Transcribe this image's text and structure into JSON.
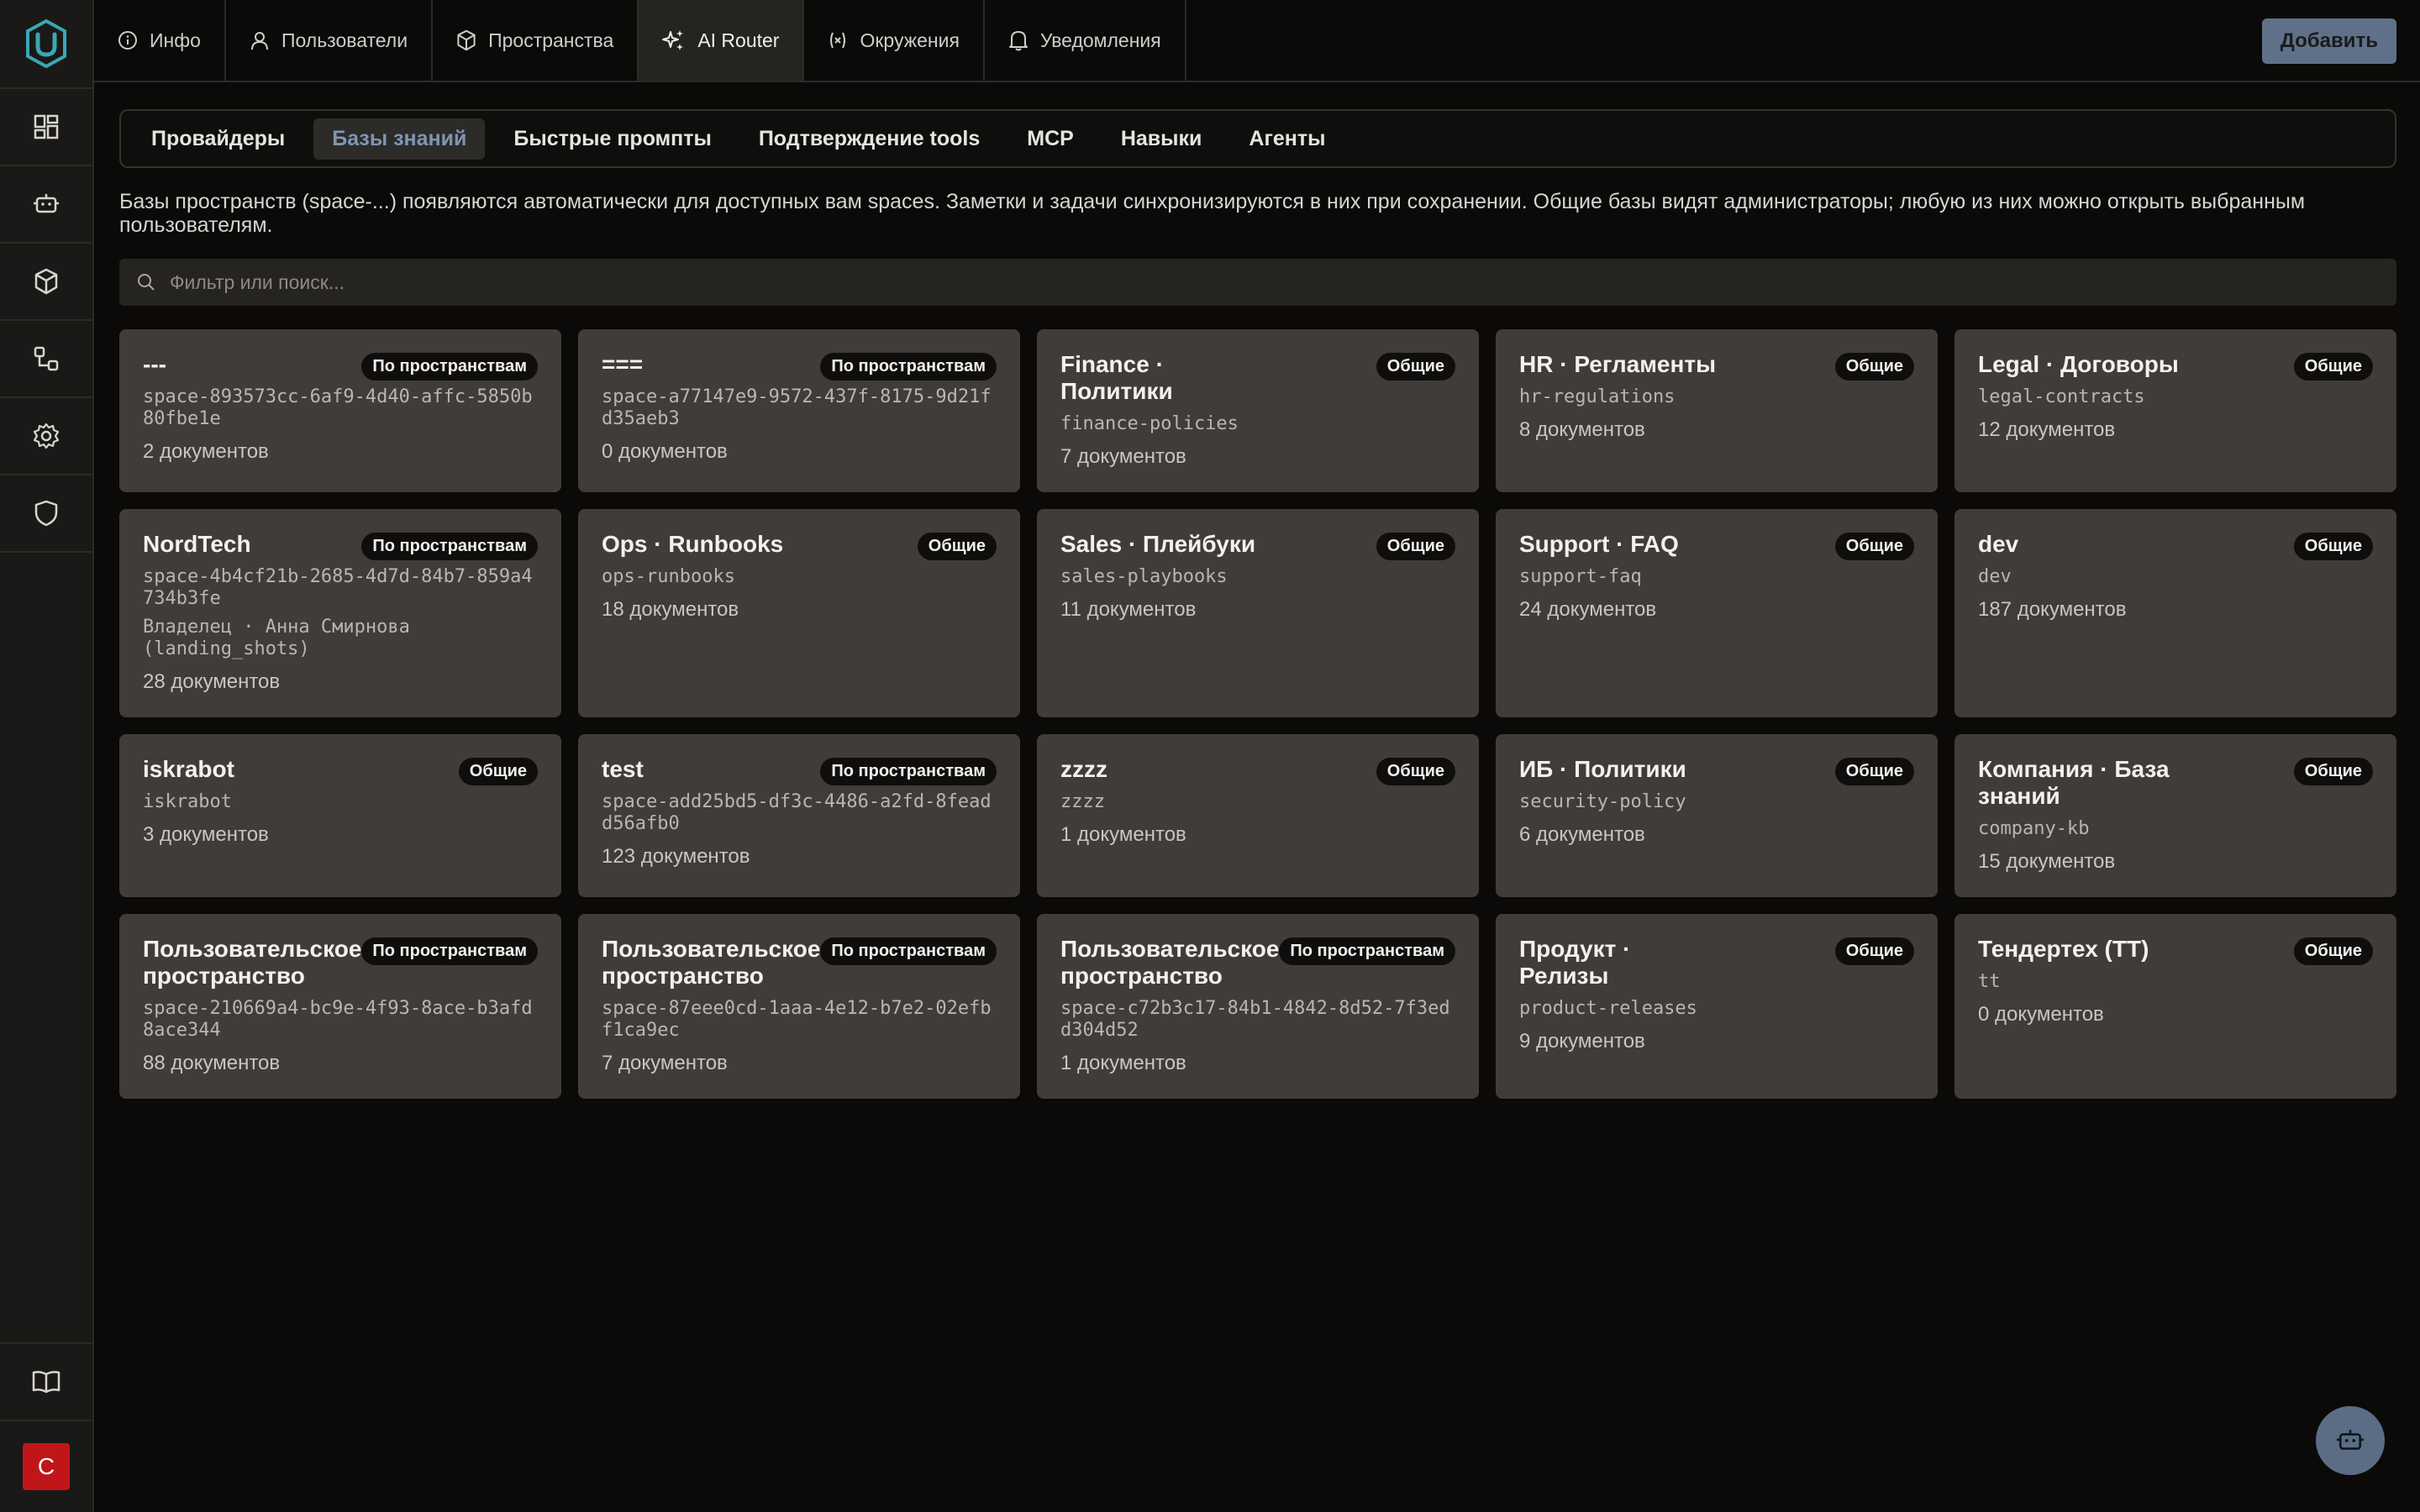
{
  "topnav": {
    "tabs": [
      {
        "label": "Инфо",
        "icon": "info-icon"
      },
      {
        "label": "Пользователи",
        "icon": "user-icon"
      },
      {
        "label": "Пространства",
        "icon": "cube-icon"
      },
      {
        "label": "AI Router",
        "icon": "sparkle-icon",
        "active": true
      },
      {
        "label": "Окружения",
        "icon": "variable-icon"
      },
      {
        "label": "Уведомления",
        "icon": "bell-icon"
      }
    ],
    "add_label": "Добавить"
  },
  "rail": {
    "items": [
      "dashboard-icon",
      "robot-icon",
      "cube-icon",
      "workflow-icon",
      "gear-icon",
      "shield-icon"
    ],
    "bottom": [
      "book-icon"
    ],
    "avatar_letter": "С",
    "avatar_color": "#c0161a"
  },
  "subtabs": [
    {
      "label": "Провайдеры"
    },
    {
      "label": "Базы знаний",
      "active": true
    },
    {
      "label": "Быстрые промпты"
    },
    {
      "label": "Подтверждение tools"
    },
    {
      "label": "MCP"
    },
    {
      "label": "Навыки"
    },
    {
      "label": "Агенты"
    }
  ],
  "description": "Базы пространств (space-...) появляются автоматически для доступных вам spaces. Заметки и задачи синхронизируются в них при сохранении. Общие базы видят администраторы; любую из них можно открыть выбранным пользователям.",
  "search": {
    "placeholder": "Фильтр или поиск...",
    "value": ""
  },
  "cards": [
    {
      "title": "---",
      "badge": "По пространствам",
      "slug": "space-893573cc-6af9-4d40-affc-5850b80fbe1e",
      "count": "2 документов"
    },
    {
      "title": "===",
      "badge": "По пространствам",
      "slug": "space-a77147e9-9572-437f-8175-9d21fd35aeb3",
      "count": "0 документов"
    },
    {
      "title": "Finance · Политики",
      "badge": "Общие",
      "slug": "finance-policies",
      "count": "7 документов"
    },
    {
      "title": "HR · Регламенты",
      "badge": "Общие",
      "slug": "hr-regulations",
      "count": "8 документов"
    },
    {
      "title": "Legal · Договоры",
      "badge": "Общие",
      "slug": "legal-contracts",
      "count": "12 документов"
    },
    {
      "title": "NordTech",
      "badge": "По пространствам",
      "slug": "space-4b4cf21b-2685-4d7d-84b7-859a4734b3fe",
      "owner": "Владелец · Анна Смирнова (landing_shots)",
      "count": "28 документов"
    },
    {
      "title": "Ops · Runbooks",
      "badge": "Общие",
      "slug": "ops-runbooks",
      "count": "18 документов"
    },
    {
      "title": "Sales · Плейбуки",
      "badge": "Общие",
      "slug": "sales-playbooks",
      "count": "11 документов"
    },
    {
      "title": "Support · FAQ",
      "badge": "Общие",
      "slug": "support-faq",
      "count": "24 документов"
    },
    {
      "title": "dev",
      "badge": "Общие",
      "slug": "dev",
      "count": "187 документов"
    },
    {
      "title": "iskrabot",
      "badge": "Общие",
      "slug": "iskrabot",
      "count": "3 документов"
    },
    {
      "title": "test",
      "badge": "По пространствам",
      "slug": "space-add25bd5-df3c-4486-a2fd-8feadd56afb0",
      "count": "123 документов"
    },
    {
      "title": "zzzz",
      "badge": "Общие",
      "slug": "zzzz",
      "count": "1 документов"
    },
    {
      "title": "ИБ · Политики",
      "badge": "Общие",
      "slug": "security-policy",
      "count": "6 документов"
    },
    {
      "title": "Компания · База знаний",
      "badge": "Общие",
      "slug": "company-kb",
      "count": "15 документов"
    },
    {
      "title": "Пользовательское пространство",
      "badge": "По пространствам",
      "slug": "space-210669a4-bc9e-4f93-8ace-b3afd8ace344",
      "count": "88 документов"
    },
    {
      "title": "Пользовательское пространство",
      "badge": "По пространствам",
      "slug": "space-87eee0cd-1aaa-4e12-b7e2-02efbf1ca9ec",
      "count": "7 документов"
    },
    {
      "title": "Пользовательское пространство",
      "badge": "По пространствам",
      "slug": "space-c72b3c17-84b1-4842-8d52-7f3edd304d52",
      "count": "1 документов"
    },
    {
      "title": "Продукт · Релизы",
      "badge": "Общие",
      "slug": "product-releases",
      "count": "9 документов"
    },
    {
      "title": "Тендертех (ТТ)",
      "badge": "Общие",
      "slug": "tt",
      "count": "0 документов"
    }
  ],
  "colors": {
    "accent": "#5f7188",
    "active_subtab_text": "#7f95b2",
    "card_bg": "#403d39"
  }
}
